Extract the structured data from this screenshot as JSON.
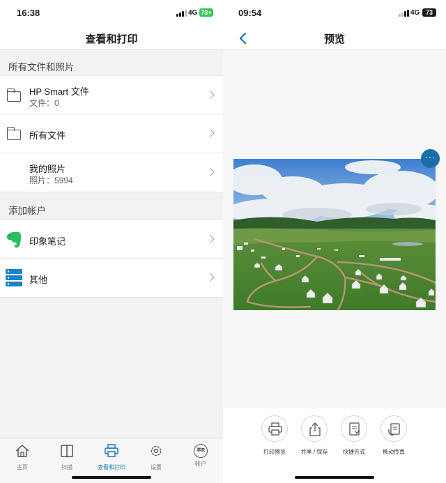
{
  "left": {
    "status": {
      "time": "16:38",
      "network": "4G",
      "battery": "78+"
    },
    "nav": {
      "title": "查看和打印"
    },
    "section_files": {
      "title": "所有文件和照片"
    },
    "rows": [
      {
        "name": "HP Smart 文件",
        "sub": "文件：0"
      },
      {
        "name": "所有文件"
      },
      {
        "name": "我的照片",
        "sub": "照片：5994"
      }
    ],
    "section_accounts": {
      "title": "添加帐户"
    },
    "accounts": [
      {
        "name": "印象笔记"
      },
      {
        "name": "其他"
      }
    ],
    "tabs": [
      {
        "label": "主页"
      },
      {
        "label": "扫描"
      },
      {
        "label": "查看和打印"
      },
      {
        "label": "设置"
      },
      {
        "label": "帐户"
      }
    ],
    "account_badge": "羊R"
  },
  "right": {
    "status": {
      "time": "09:54",
      "network": "4G",
      "battery": "73"
    },
    "nav": {
      "title": "预览"
    },
    "more": "···",
    "actions": [
      {
        "label": "打印预览"
      },
      {
        "label": "共享 / 保存"
      },
      {
        "label": "快捷方式"
      },
      {
        "label": "移动传真"
      }
    ]
  },
  "colors": {
    "accent": "#1b7bb5",
    "battery_green": "#34c759",
    "evernote": "#2dbe60",
    "fab": "#1a6fa8"
  }
}
